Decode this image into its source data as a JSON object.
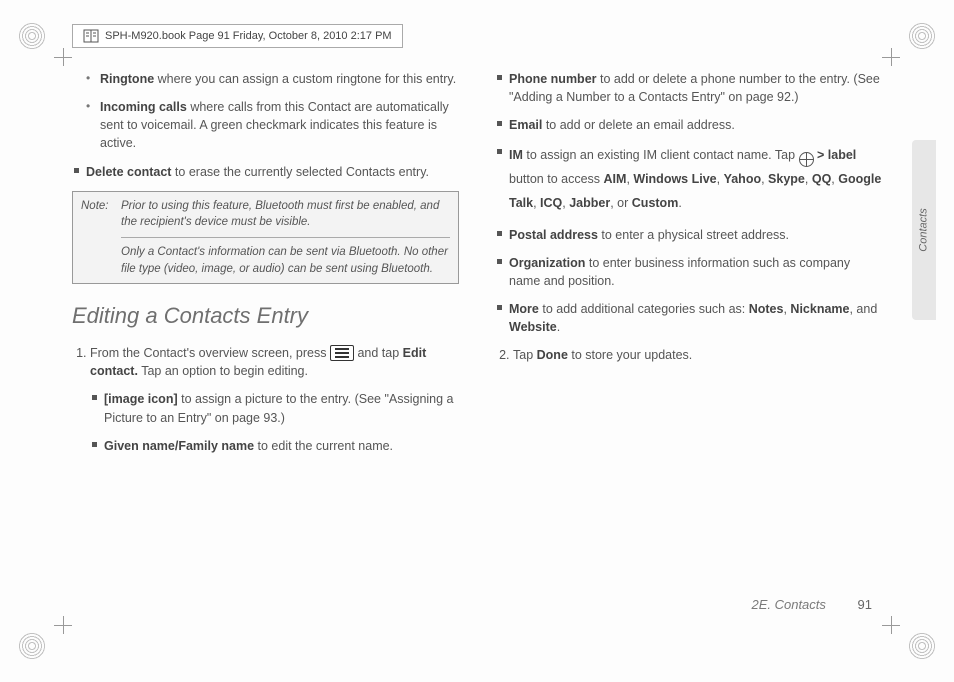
{
  "header": "SPH-M920.book  Page 91  Friday, October 8, 2010  2:17 PM",
  "side_tab": "Contacts",
  "footer": {
    "section": "2E. Contacts",
    "page": "91"
  },
  "col1": {
    "ringtone_b": "Ringtone",
    "ringtone_t": " where you can assign a custom ringtone for this entry.",
    "incoming_b": "Incoming calls",
    "incoming_t": " where calls from this Contact are automatically sent to voicemail. A green checkmark indicates this feature is active.",
    "delete_b": "Delete contact",
    "delete_t": " to erase the currently selected Contacts entry.",
    "note_prefix": "Note:",
    "note1": "Prior to using this feature, Bluetooth must first be enabled, and the recipient's device must be visible.",
    "note2": "Only a Contact's information can be sent via Bluetooth. No other file type (video, image, or audio) can be sent using Bluetooth.",
    "section_heading": "Editing a Contacts Entry",
    "step1_a": "From the Contact's overview screen, press ",
    "step1_b": " and tap ",
    "step1_edit_b": "Edit contact.",
    "step1_c": " Tap an option to begin editing.",
    "image_b": "[image icon]",
    "image_t": " to assign a picture to the entry. (See \"Assigning a Picture to an Entry\" on page 93.)",
    "given_b": "Given name/Family name",
    "given_t": " to edit the current name."
  },
  "col2": {
    "phone_b": "Phone number",
    "phone_t": " to add or delete a phone number to the entry. (See \"Adding a Number to a Contacts Entry\" on page 92.)",
    "email_b": "Email",
    "email_t": " to add or delete an email address.",
    "im_b": "IM",
    "im_t1": " to assign an existing IM client contact name. Tap ",
    "im_gt": " > ",
    "im_label_b": "label",
    "im_t2": " button to access ",
    "im_list_1": "AIM",
    "im_list_2": "Windows Live",
    "im_list_3": "Yahoo",
    "im_list_4": "Skype",
    "im_list_5": "QQ",
    "im_list_6": "Google Talk",
    "im_list_7": "ICQ",
    "im_list_8": "Jabber",
    "im_or": ", or ",
    "im_list_9": "Custom",
    "im_period": ".",
    "postal_b": "Postal address",
    "postal_t": " to enter a physical street address.",
    "org_b": "Organization",
    "org_t": " to enter business information such as company name and position.",
    "more_b": "More",
    "more_t1": " to add additional categories such as: ",
    "more_notes": "Notes",
    "more_nick": "Nickname",
    "more_and": ", and ",
    "more_web": "Website",
    "more_period": ".",
    "step2_a": "Tap ",
    "step2_done": "Done",
    "step2_b": " to store your updates."
  }
}
